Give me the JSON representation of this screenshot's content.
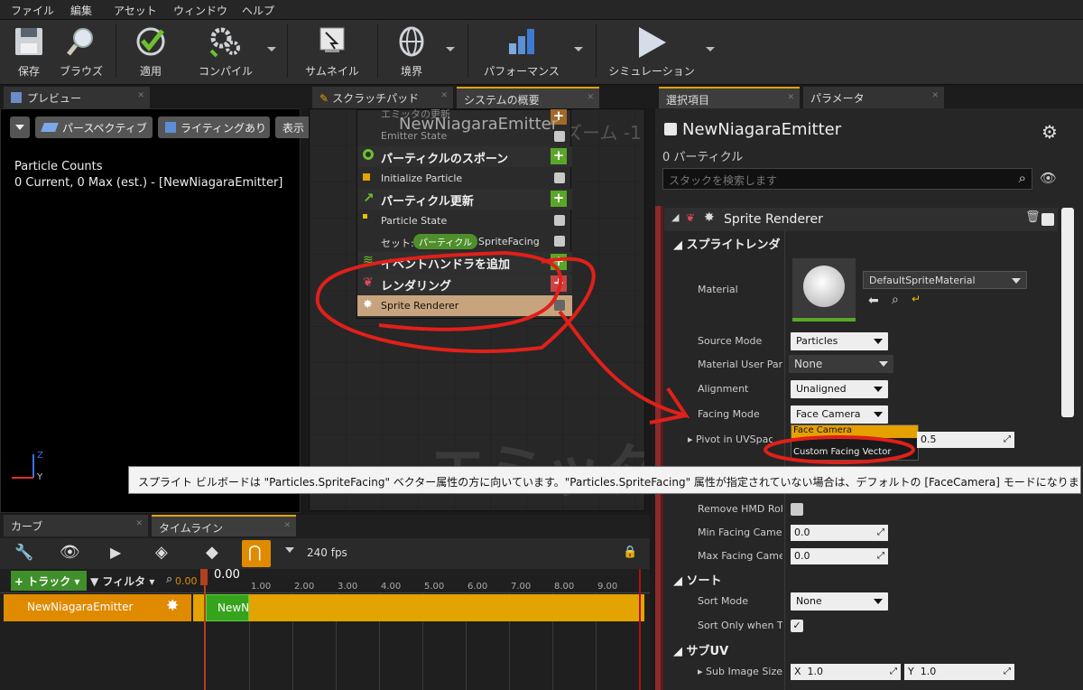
{
  "menu": {
    "items": [
      "ファイル",
      "編集",
      "アセット",
      "ウィンドウ",
      "ヘルプ"
    ]
  },
  "toolbar": {
    "save": "保存",
    "browse": "ブラウズ",
    "apply": "適用",
    "compile": "コンパイル",
    "thumbnail": "サムネイル",
    "bounds": "境界",
    "performance": "パフォーマンス",
    "simulation": "シミュレーション"
  },
  "tabs": {
    "preview": "プレビュー",
    "scratchpad": "スクラッチパッド",
    "system_overview": "システムの概要",
    "selected": "選択項目",
    "parameters": "パラメータ",
    "curves": "カーブ",
    "timeline": "タイムライン"
  },
  "preview": {
    "perspective": "パースペクティブ",
    "lighting": "ライティングあり",
    "show": "表示",
    "counts_title": "Particle Counts",
    "counts_text": "0 Current, 0 Max (est.) - [NewNiagaraEmitter]",
    "axis_z": "Z",
    "axis_y": "Y"
  },
  "graph": {
    "emitter_name": "NewNiagaraEmitter",
    "zoom": "ズーム -1",
    "emitter_update": "エミッタの更新",
    "emitter_state": "Emitter State",
    "particle_spawn": "パーティクルのスポーン",
    "initialize_particle": "Initialize Particle",
    "particle_update": "パーティクル更新",
    "particle_state": "Particle State",
    "set_label": "セット:",
    "set_badge": "パーティクル",
    "set_value": "SpriteFacing",
    "add_event_handler": "イベントハンドラを追加",
    "rendering": "レンダリング",
    "sprite_renderer": "Sprite Renderer",
    "watermark": "エミッタ"
  },
  "details": {
    "emitter_name": "NewNiagaraEmitter",
    "particle_count": "0 パーティクル",
    "search_placeholder": "スタックを検索します",
    "renderer_title": "Sprite Renderer",
    "section_sprite": "スプライトレンダ",
    "material_label": "Material",
    "material_value": "DefaultSpriteMaterial",
    "source_mode_label": "Source Mode",
    "source_mode_value": "Particles",
    "material_user_param_label": "Material User Para",
    "material_user_param_value": "None",
    "alignment_label": "Alignment",
    "alignment_value": "Unaligned",
    "facing_mode_label": "Facing Mode",
    "facing_mode_value": "Face Camera",
    "facing_option_1": "Face Camera",
    "facing_option_2": "Custom Facing Vector",
    "pivot_label": "Pivot in UVSpace",
    "pivot_y": "0.5",
    "remove_hmd_label": "Remove HMD Roll",
    "min_facing_label": "Min Facing Camera",
    "min_facing_value": "0.0",
    "max_facing_label": "Max Facing Camer",
    "max_facing_value": "0.0",
    "section_sort": "ソート",
    "sort_mode_label": "Sort Mode",
    "sort_mode_value": "None",
    "sort_only_label": "Sort Only when Tra",
    "section_subuv": "サブUV",
    "sub_image_label": "Sub Image Size",
    "sub_image_x_label": "X",
    "sub_image_x": "1.0",
    "sub_image_y_label": "Y",
    "sub_image_y": "1.0"
  },
  "tooltip": {
    "text": "スプライト ビルボードは \"Particles.SpriteFacing\" ベクター属性の方に向いています。\"Particles.SpriteFacing\" 属性が指定されていない場合は、デフォルトの [FaceCamera] モードになります。"
  },
  "timeline": {
    "track_btn": "トラック",
    "filter_btn": "フィルタ",
    "time_small": "0.00",
    "current_time": "0.00",
    "fps": "240 fps",
    "ticks": [
      "1.00",
      "2.00",
      "3.00",
      "4.00",
      "5.00",
      "6.00",
      "7.00",
      "8.00",
      "9.00"
    ],
    "track_name": "NewNiagaraEmitter",
    "clip_label": "NewN"
  },
  "colors": {
    "accent": "#e5a100",
    "annotation": "#e0201a",
    "green": "#5aa628"
  }
}
